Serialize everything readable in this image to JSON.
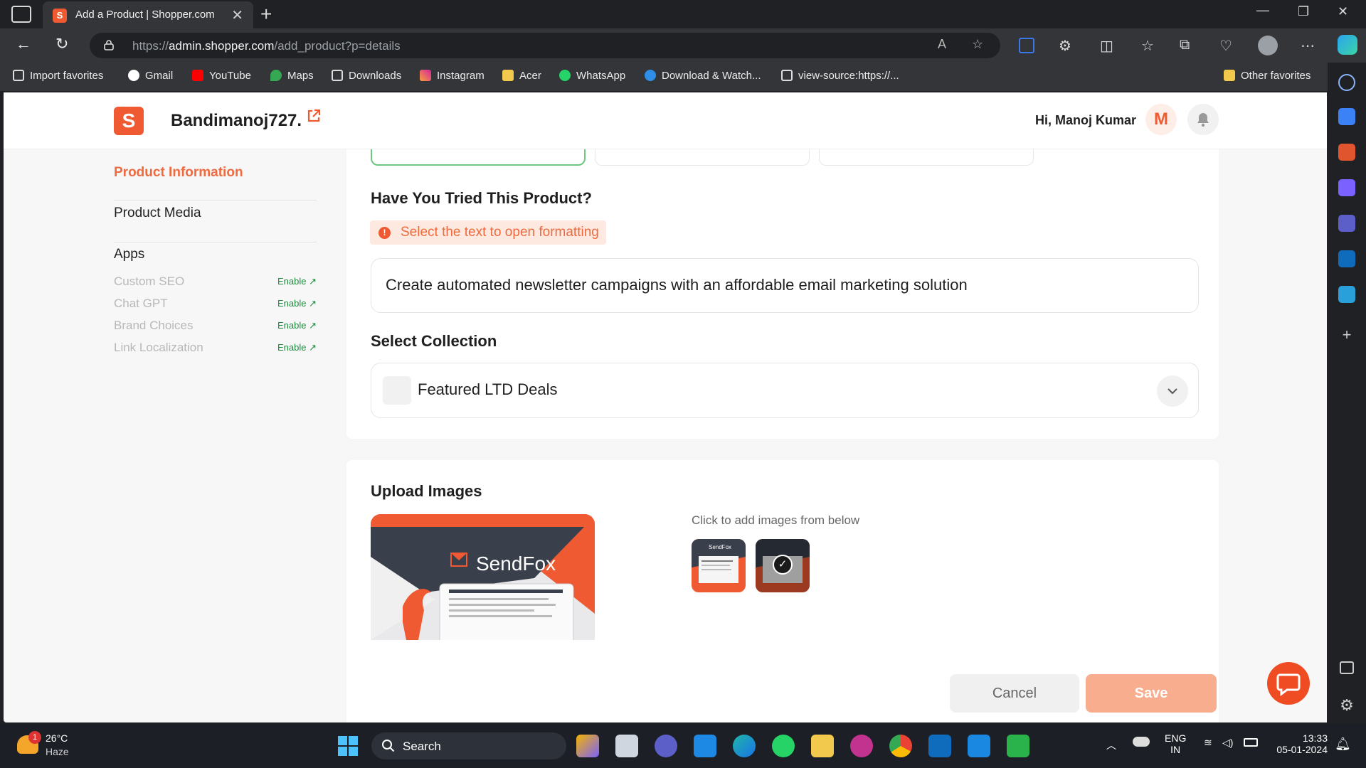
{
  "browser": {
    "tab_title": "Add a Product | Shopper.com",
    "tab_favicon": "S",
    "url_prefix": "https://",
    "url_domain": "admin.shopper.com",
    "url_path": "/add_product?p=details",
    "bookmarks": [
      "Import favorites",
      "Gmail",
      "YouTube",
      "Maps",
      "Downloads",
      "Instagram",
      "Acer",
      "WhatsApp",
      "Download & Watch...",
      "view-source:https://...",
      "Other favorites"
    ]
  },
  "header": {
    "logo_letter": "S",
    "store_name": "Bandimanoj727.",
    "greeting": "Hi, Manoj Kumar",
    "avatar_letter": "M"
  },
  "sidebar": {
    "product_information": "Product Information",
    "product_media": "Product Media",
    "apps_title": "Apps",
    "apps": [
      {
        "name": "Custom SEO",
        "action": "Enable"
      },
      {
        "name": "Chat GPT",
        "action": "Enable"
      },
      {
        "name": "Brand Choices",
        "action": "Enable"
      },
      {
        "name": "Link Localization",
        "action": "Enable"
      }
    ]
  },
  "details": {
    "tried_title": "Have You Tried This Product?",
    "hint": "Select the text to open formatting",
    "description": "Create automated newsletter campaigns with an affordable email marketing solution",
    "collection_title": "Select Collection",
    "collection_value": "Featured LTD Deals"
  },
  "media": {
    "title": "Upload Images",
    "click_hint": "Click to add images from below",
    "image_brand": "SendFox"
  },
  "actions": {
    "cancel": "Cancel",
    "save": "Save"
  },
  "taskbar": {
    "temperature": "26°C",
    "weather": "Haze",
    "weather_badge": "1",
    "search": "Search",
    "lang": "ENG",
    "region": "IN",
    "time": "13:33",
    "date": "05-01-2024"
  },
  "colors": {
    "brand": "#ef5a33",
    "accent_text": "#ef6a3f",
    "save_disabled": "#f9ad8f",
    "enable_green": "#1f8a3f"
  }
}
